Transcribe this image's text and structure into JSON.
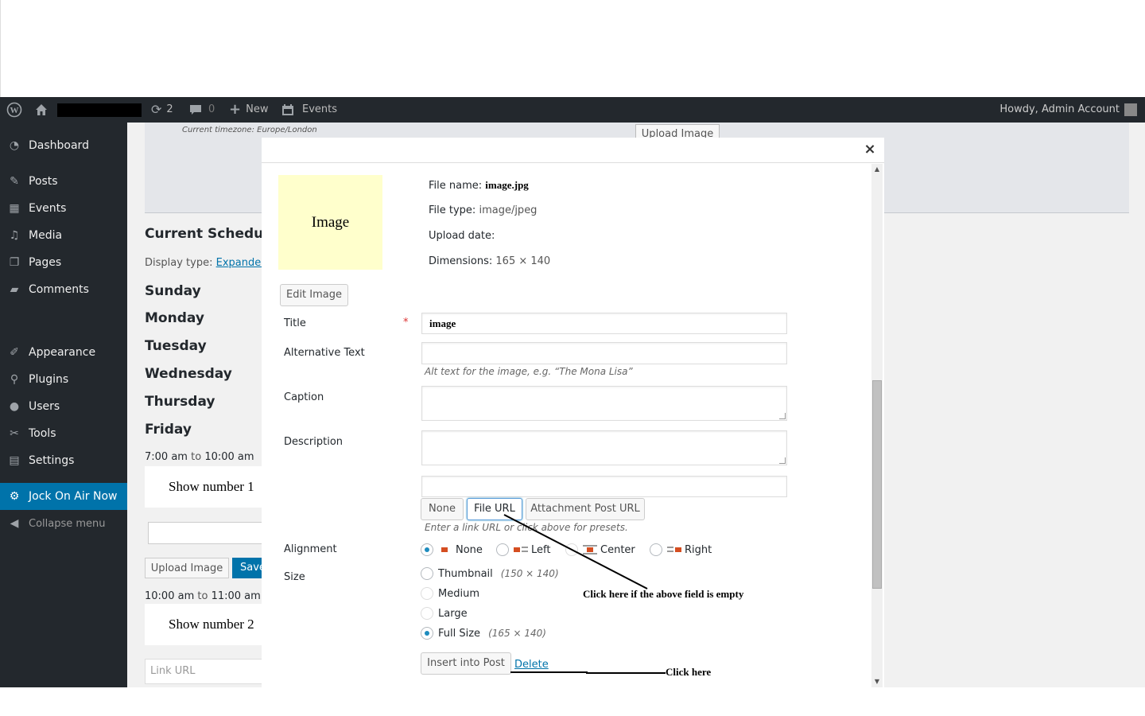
{
  "adminbar": {
    "updates_count": "2",
    "comments_count": "0",
    "new_label": "New",
    "events_label": "Events",
    "howdy": "Howdy, Admin Account"
  },
  "sidebar": {
    "items": [
      {
        "label": "Dashboard",
        "icon": "dashboard-icon"
      },
      {
        "label": "Posts",
        "icon": "pin-icon"
      },
      {
        "label": "Events",
        "icon": "calendar-icon"
      },
      {
        "label": "Media",
        "icon": "media-icon"
      },
      {
        "label": "Pages",
        "icon": "pages-icon"
      },
      {
        "label": "Comments",
        "icon": "comment-icon"
      },
      {
        "label": "Appearance",
        "icon": "brush-icon"
      },
      {
        "label": "Plugins",
        "icon": "plugin-icon"
      },
      {
        "label": "Users",
        "icon": "user-icon"
      },
      {
        "label": "Tools",
        "icon": "wrench-icon"
      },
      {
        "label": "Settings",
        "icon": "settings-icon"
      },
      {
        "label": "Jock On Air Now",
        "icon": "gear-icon"
      },
      {
        "label": "Collapse menu",
        "icon": "collapse-icon"
      }
    ]
  },
  "background": {
    "timezone": "Current timezone: Europe/London",
    "upload_image": "Upload Image",
    "schedule_title": "Current Schedule",
    "display_type_label": "Display type:",
    "display_type_value": "Expanded",
    "days": [
      "Sunday",
      "Monday",
      "Tuesday",
      "Wednesday",
      "Thursday",
      "Friday"
    ],
    "slot1": {
      "start": "7:00 am",
      "to": "to",
      "end": "10:00 am"
    },
    "slot2": {
      "start": "10:00 am",
      "to": "to",
      "end": "11:00 am"
    },
    "show1": "Show number 1",
    "show2": "Show number 2",
    "upload_button": "Upload Image",
    "save_button": "Save",
    "link_url_placeholder": "Link URL"
  },
  "modal": {
    "close": "×",
    "thumbnail_text": "Image",
    "file_name_label": "File name:",
    "file_name_value": "image.jpg",
    "file_type_label": "File type:",
    "file_type_value": "image/jpeg",
    "upload_date_label": "Upload date:",
    "dimensions_label": "Dimensions:",
    "dimensions_value": "165 × 140",
    "edit_image": "Edit Image",
    "title_label": "Title",
    "required_mark": "*",
    "title_value": "image",
    "alt_label": "Alternative Text",
    "alt_value": "",
    "alt_help": "Alt text for the image, e.g. “The Mona Lisa”",
    "caption_label": "Caption",
    "description_label": "Description",
    "link_value": "",
    "link_buttons": [
      "None",
      "File URL",
      "Attachment Post URL"
    ],
    "link_help": "Enter a link URL or click above for presets.",
    "alignment_label": "Alignment",
    "alignments": [
      "None",
      "Left",
      "Center",
      "Right"
    ],
    "size_label": "Size",
    "sizes": [
      {
        "label": "Thumbnail",
        "hint": "(150 × 140)"
      },
      {
        "label": "Medium",
        "hint": ""
      },
      {
        "label": "Large",
        "hint": ""
      },
      {
        "label": "Full Size",
        "hint": "(165 × 140)"
      }
    ],
    "insert_button": "Insert into Post",
    "delete_link": "Delete"
  },
  "annotations": {
    "click_empty": "Click here if the above field is empty",
    "click_here": "Click here"
  },
  "colors": {
    "admin_dark": "#23282d",
    "accent": "#0073aa",
    "thumbnail_bg": "#ffffcc"
  }
}
